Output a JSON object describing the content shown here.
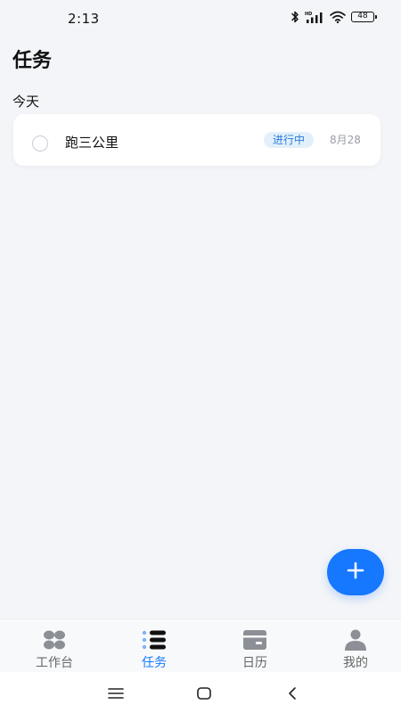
{
  "status_bar": {
    "time": "2:13",
    "battery": "48",
    "icons": [
      "bluetooth-icon",
      "hd-signal-icon",
      "wifi-icon",
      "battery-icon"
    ]
  },
  "header": {
    "title": "任务"
  },
  "sections": [
    {
      "title": "今天",
      "tasks": [
        {
          "title": "跑三公里",
          "status": "进行中",
          "date": "8月28"
        }
      ]
    }
  ],
  "fab": {
    "icon": "plus-icon"
  },
  "bottom_nav": {
    "items": [
      {
        "label": "工作台",
        "icon": "grid-icon",
        "active": false
      },
      {
        "label": "任务",
        "icon": "list-icon",
        "active": true
      },
      {
        "label": "日历",
        "icon": "calendar-icon",
        "active": false
      },
      {
        "label": "我的",
        "icon": "person-icon",
        "active": false
      }
    ]
  },
  "system_nav": {
    "icons": [
      "menu-icon",
      "home-icon",
      "back-icon"
    ]
  },
  "colors": {
    "accent": "#1677ff",
    "badge_bg": "#e3f0fb",
    "badge_text": "#2a7bd9",
    "background": "#f4f5f8",
    "inactive_icon": "#8c8f96"
  }
}
